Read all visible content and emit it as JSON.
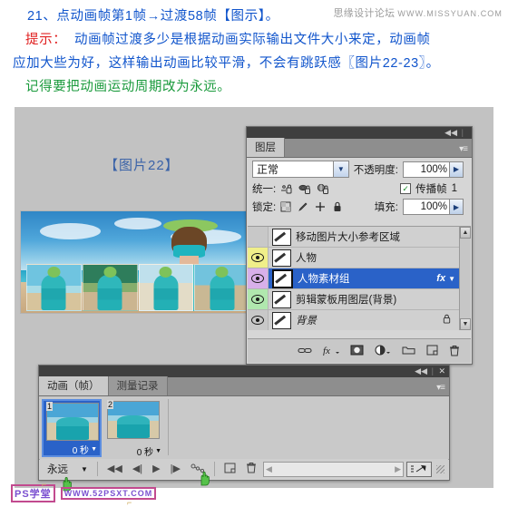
{
  "tutorial": {
    "step_line": "21、点动画帧第1帧→过渡58帧【图示】。",
    "tip_label": "提示：",
    "tip_line1": "动画帧过渡多少是根据动画实际输出文件大小来定，动画帧",
    "tip_line2": "应加大些为好，这样输出动画比较平滑，不会有跳跃感〖图片22-23〗。",
    "note_line": "记得要把动画运动周期改为永远。"
  },
  "watermark_top": {
    "site_cn": "思缘设计论坛",
    "site_url": "WWW.MISSYUAN.COM"
  },
  "watermark_bottom": {
    "brand": "PS学堂",
    "url": "WWW.52PSXT.COM"
  },
  "figure_label": "【图片22】",
  "layers_panel": {
    "tab_label": "图层",
    "blend_mode": "正常",
    "opacity_label": "不透明度:",
    "opacity_value": "100%",
    "unify_label": "统一:",
    "unify_icons": [
      "unify-position-icon",
      "unify-visibility-icon",
      "unify-style-icon"
    ],
    "propagate_label": "传播帧",
    "propagate_value": "1",
    "propagate_checked": true,
    "lock_label": "锁定:",
    "lock_icons": [
      "lock-transparency-icon",
      "lock-image-icon",
      "lock-position-icon",
      "lock-all-icon"
    ],
    "fill_label": "填充:",
    "fill_value": "100%",
    "layers": [
      {
        "name": "移动图片大小参考区域",
        "visible": false,
        "eye_color": "#c8c8c8",
        "selected": false,
        "italic": false,
        "has_fx": false,
        "locked": false
      },
      {
        "name": "人物",
        "visible": true,
        "eye_color": "#f0ef8a",
        "selected": false,
        "italic": false,
        "has_fx": false,
        "locked": false
      },
      {
        "name": "人物素材组",
        "visible": true,
        "eye_color": "#d8b0ea",
        "selected": true,
        "italic": false,
        "has_fx": true,
        "locked": false
      },
      {
        "name": "剪辑蒙板用图层(背景)",
        "visible": true,
        "eye_color": "#b0e8ae",
        "selected": false,
        "italic": false,
        "has_fx": false,
        "locked": false
      },
      {
        "name": "背景",
        "visible": true,
        "eye_color": "#c8c8c8",
        "selected": false,
        "italic": true,
        "has_fx": false,
        "locked": true
      }
    ],
    "bottom_icons": [
      "link-layers-icon",
      "layer-style-fx-icon",
      "add-layer-mask-icon",
      "adjustment-layer-icon",
      "new-group-icon",
      "new-layer-icon",
      "delete-layer-icon"
    ]
  },
  "animation_panel": {
    "tab_active": "动画（帧）",
    "tab_inactive": "测量记录",
    "frames": [
      {
        "number": "1",
        "delay": "0 秒",
        "selected": true
      },
      {
        "number": "2",
        "delay": "0 秒",
        "selected": false
      }
    ],
    "loop_value": "永远",
    "controls": [
      "select-first-frame-icon",
      "select-previous-frame-icon",
      "play-animation-icon",
      "select-next-frame-icon",
      "tween-frames-icon",
      "duplicate-frame-icon",
      "delete-frame-icon"
    ],
    "convert_button": "convert-to-timeline-icon"
  },
  "colors": {
    "canvas_bg": "#c2c2c2",
    "panel_bg": "#d6d6d6",
    "selection_blue": "#2a62c8",
    "text_blue": "#1155cc",
    "text_red": "#e02020",
    "text_green": "#1a9a3c"
  }
}
